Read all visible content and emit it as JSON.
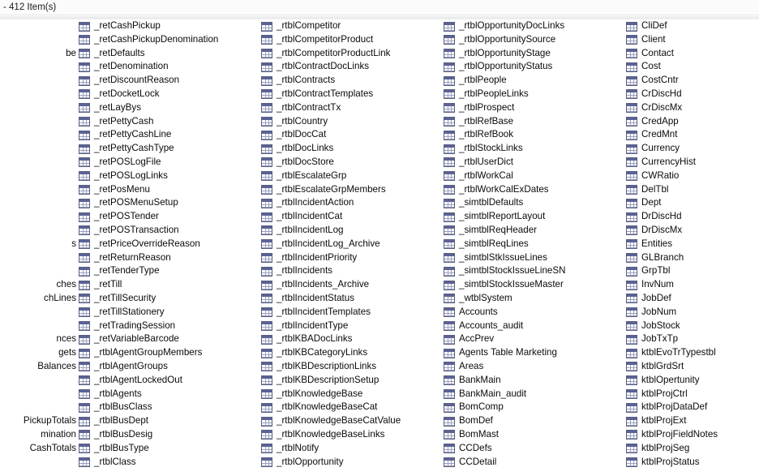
{
  "window": {
    "status_text": "- 412 Item(s)",
    "icon_name": "table-datasheet-icon",
    "accent_color": "#5a6296",
    "background_color": "#ffffff",
    "strip_color": "#fbfbfb",
    "band_color": "#eceded"
  },
  "list": {
    "item_count": 412,
    "columns": [
      {
        "index": 0,
        "clipped": true,
        "items": [
          "",
          "",
          "be",
          "",
          "",
          "",
          "",
          "",
          "",
          "",
          "",
          "",
          "",
          "",
          "",
          "",
          "s",
          "",
          "",
          "ches",
          "chLines",
          "",
          "",
          "nces",
          "gets",
          "Balances",
          "",
          "",
          "",
          "PickupTotals",
          "mination",
          "CashTotals",
          ""
        ]
      },
      {
        "index": 1,
        "clipped": false,
        "items": [
          "_retCashPickup",
          "_retCashPickupDenomination",
          "_retDefaults",
          "_retDenomination",
          "_retDiscountReason",
          "_retDocketLock",
          "_retLayBys",
          "_retPettyCash",
          "_retPettyCashLine",
          "_retPettyCashType",
          "_retPOSLogFile",
          "_retPOSLogLinks",
          "_retPosMenu",
          "_retPOSMenuSetup",
          "_retPOSTender",
          "_retPOSTransaction",
          "_retPriceOverrideReason",
          "_retReturnReason",
          "_retTenderType",
          "_retTill",
          "_retTillSecurity",
          "_retTillStationery",
          "_retTradingSession",
          "_retVariableBarcode",
          "_rtblAgentGroupMembers",
          "_rtblAgentGroups",
          "_rtblAgentLockedOut",
          "_rtblAgents",
          "_rtblBusClass",
          "_rtblBusDept",
          "_rtblBusDesig",
          "_rtblBusType",
          "_rtblClass"
        ]
      },
      {
        "index": 2,
        "clipped": false,
        "items": [
          "_rtblCompetitor",
          "_rtblCompetitorProduct",
          "_rtblCompetitorProductLink",
          "_rtblContractDocLinks",
          "_rtblContracts",
          "_rtblContractTemplates",
          "_rtblContractTx",
          "_rtblCountry",
          "_rtblDocCat",
          "_rtblDocLinks",
          "_rtblDocStore",
          "_rtblEscalateGrp",
          "_rtblEscalateGrpMembers",
          "_rtblIncidentAction",
          "_rtblIncidentCat",
          "_rtblIncidentLog",
          "_rtblIncidentLog_Archive",
          "_rtblIncidentPriority",
          "_rtblIncidents",
          "_rtblIncidents_Archive",
          "_rtblIncidentStatus",
          "_rtblIncidentTemplates",
          "_rtblIncidentType",
          "_rtblKBADocLinks",
          "_rtblKBCategoryLinks",
          "_rtblKBDescriptionLinks",
          "_rtblKBDescriptionSetup",
          "_rtblKnowledgeBase",
          "_rtblKnowledgeBaseCat",
          "_rtblKnowledgeBaseCatValue",
          "_rtblKnowledgeBaseLinks",
          "_rtblNotify",
          "_rtblOpportunity"
        ]
      },
      {
        "index": 3,
        "clipped": false,
        "items": [
          "_rtblOpportunityDocLinks",
          "_rtblOpportunitySource",
          "_rtblOpportunityStage",
          "_rtblOpportunityStatus",
          "_rtblPeople",
          "_rtblPeopleLinks",
          "_rtblProspect",
          "_rtblRefBase",
          "_rtblRefBook",
          "_rtblStockLinks",
          "_rtblUserDict",
          "_rtblWorkCal",
          "_rtblWorkCalExDates",
          "_simtblDefaults",
          "_simtblReportLayout",
          "_simtblReqHeader",
          "_simtblReqLines",
          "_simtblStkIssueLines",
          "_simtblStockIssueLineSN",
          "_simtblStockIssueMaster",
          "_wtblSystem",
          "Accounts",
          "Accounts_audit",
          "AccPrev",
          "Agents Table Marketing",
          "Areas",
          "BankMain",
          "BankMain_audit",
          "BomComp",
          "BomDef",
          "BomMast",
          "CCDefs",
          "CCDetail"
        ]
      },
      {
        "index": 4,
        "clipped": false,
        "items": [
          "CliDef",
          "Client",
          "Contact",
          "Cost",
          "CostCntr",
          "CrDiscHd",
          "CrDiscMx",
          "CredApp",
          "CredMnt",
          "Currency",
          "CurrencyHist",
          "CWRatio",
          "DelTbl",
          "Dept",
          "DrDiscHd",
          "DrDiscMx",
          "Entities",
          "GLBranch",
          "GrpTbl",
          "InvNum",
          "JobDef",
          "JobNum",
          "JobStock",
          "JobTxTp",
          "ktblEvoTrTypestbl",
          "ktblGrdSrt",
          "ktblOpertunity",
          "ktblProjCtrl",
          "ktblProjDataDef",
          "ktblProjExt",
          "ktblProjFieldNotes",
          "ktblProjSeg",
          "ktblProjStatus"
        ]
      }
    ]
  }
}
